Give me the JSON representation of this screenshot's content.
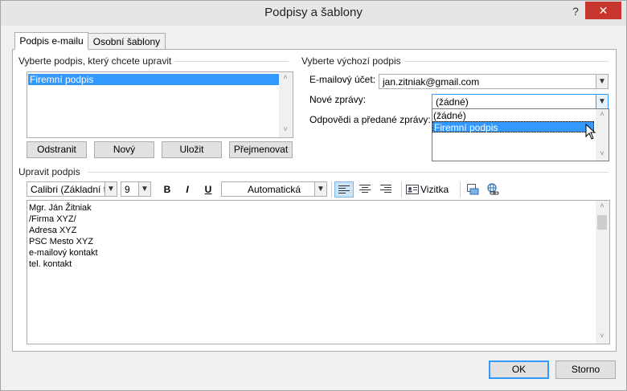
{
  "window": {
    "title": "Podpisy a šablony",
    "help": "?",
    "close": "✕"
  },
  "tabs": [
    {
      "label": "Podpis e-mailu",
      "active": true
    },
    {
      "label": "Osobní šablony",
      "active": false
    }
  ],
  "select_signature": {
    "label": "Vyberte podpis, který chcete upravit",
    "items": [
      "Firemní podpis"
    ],
    "buttons": {
      "delete": "Odstranit",
      "new": "Nový",
      "save": "Uložit",
      "rename": "Přejmenovat"
    }
  },
  "default_signature": {
    "label": "Vyberte výchozí podpis",
    "email_account_label": "E-mailový účet:",
    "email_account_value": "jan.zitniak@gmail.com",
    "new_messages_label": "Nové zprávy:",
    "new_messages_value": "(žádné)",
    "replies_label": "Odpovědi a předané zprávy:",
    "dropdown_options": [
      "(žádné)",
      "Firemní podpis"
    ]
  },
  "edit_signature": {
    "label": "Upravit podpis",
    "font": "Calibri (Základní te",
    "size": "9",
    "bold": "B",
    "italic": "I",
    "underline": "U",
    "color": "Automatická",
    "business_card": "Vizitka",
    "content": [
      "Mgr. Ján Žitniak",
      "/Firma XYZ/",
      "Adresa XYZ",
      "PSC Mesto XYZ",
      "e-mailový kontakt",
      "tel. kontakt"
    ]
  },
  "footer": {
    "ok": "OK",
    "cancel": "Storno"
  },
  "colors": {
    "selection": "#3399ff",
    "close": "#c7372f"
  }
}
